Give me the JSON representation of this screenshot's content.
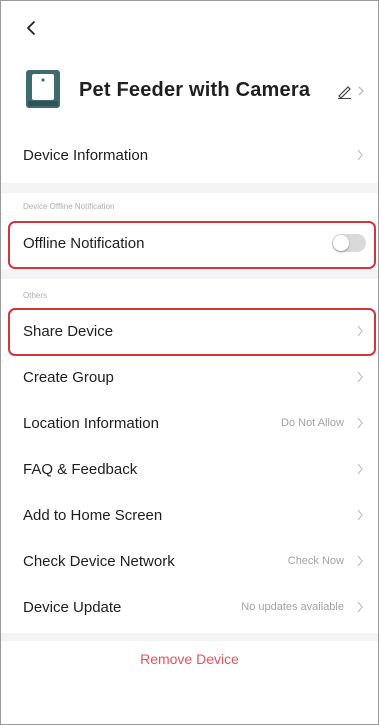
{
  "device": {
    "name": "Pet Feeder with Camera"
  },
  "rows": {
    "device_information": "Device Information",
    "offline_notification": "Offline Notification",
    "share_device": "Share Device",
    "create_group": "Create Group",
    "location_information": "Location Information",
    "location_value": "Do Not Allow",
    "faq_feedback": "FAQ & Feedback",
    "add_home_screen": "Add to Home Screen",
    "check_network": "Check Device Network",
    "check_network_value": "Check Now",
    "device_update": "Device Update",
    "device_update_value": "No updates available"
  },
  "sections": {
    "offline": "Device Offline Notification",
    "others": "Others"
  },
  "toggle": {
    "offline_notification_on": false
  },
  "actions": {
    "remove_device": "Remove Device"
  },
  "colors": {
    "accent_red": "#d3343e",
    "remove_text": "#e05560",
    "device_icon": "#3f6b6f",
    "divider_bg": "#f4f4f6"
  },
  "icons": {
    "back": "chevron-left-icon",
    "device": "pet-feeder-icon",
    "edit": "pencil-icon",
    "row_arrow": "chevron-right-icon"
  }
}
